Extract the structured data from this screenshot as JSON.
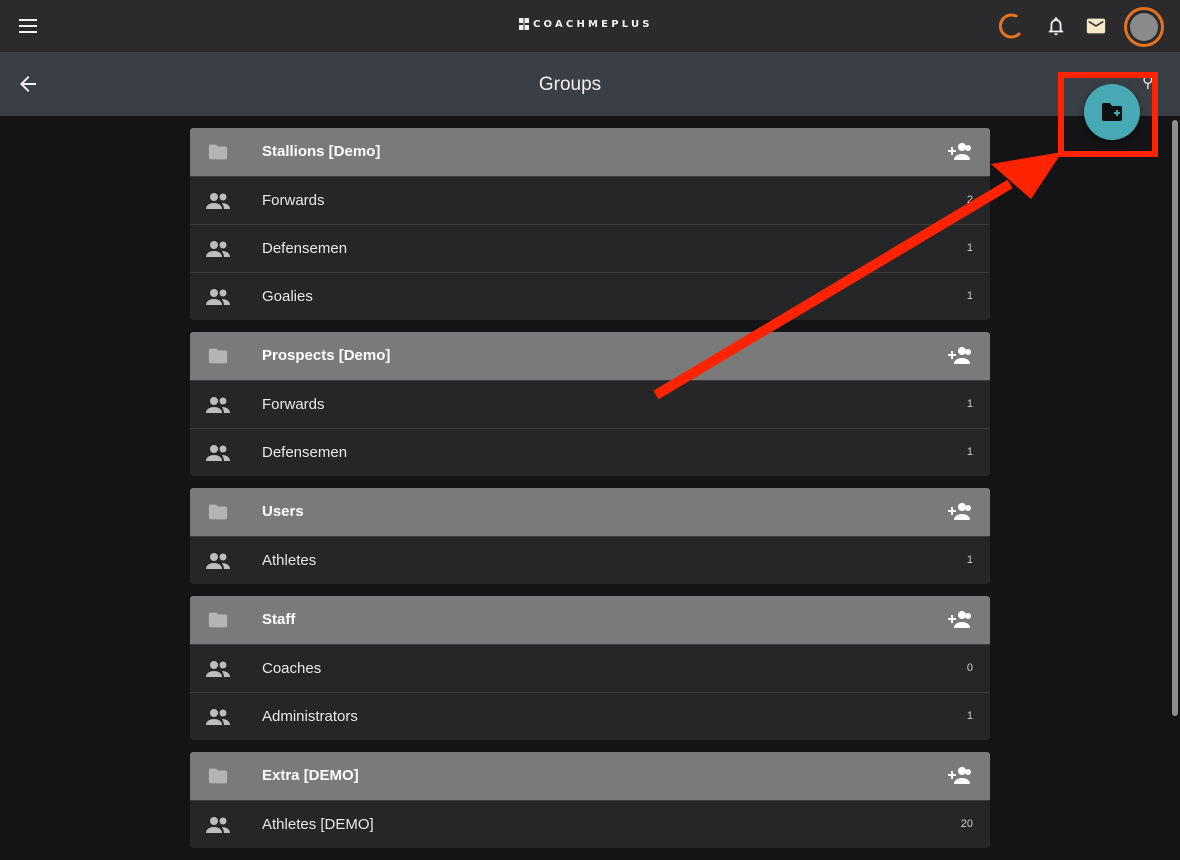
{
  "app": {
    "logo_text": "COACHMEPLUS"
  },
  "header": {
    "title": "Groups"
  },
  "colors": {
    "accent": "#47a9b3",
    "avatar_ring": "#e8731e",
    "annotation": "#ff2300",
    "group_header": "#7a7a7a"
  },
  "icons": {
    "menu": "menu-icon",
    "logo": "logo-mark-icon",
    "loading": "loading-spinner-icon",
    "notifications": "bell-icon",
    "messages": "mail-icon",
    "back": "arrow-back-icon",
    "folder": "folder-icon",
    "add_member": "person-add-icon",
    "group_row": "people-icon",
    "create_folder": "create-new-folder-icon"
  },
  "groups": [
    {
      "name": "Stallions [Demo]",
      "rows": [
        {
          "label": "Forwards",
          "count": "2"
        },
        {
          "label": "Defensemen",
          "count": "1"
        },
        {
          "label": "Goalies",
          "count": "1"
        }
      ]
    },
    {
      "name": "Prospects [Demo]",
      "rows": [
        {
          "label": "Forwards",
          "count": "1"
        },
        {
          "label": "Defensemen",
          "count": "1"
        }
      ]
    },
    {
      "name": "Users",
      "rows": [
        {
          "label": "Athletes",
          "count": "1"
        }
      ]
    },
    {
      "name": "Staff",
      "rows": [
        {
          "label": "Coaches",
          "count": "0"
        },
        {
          "label": "Administrators",
          "count": "1"
        }
      ]
    },
    {
      "name": "Extra [DEMO]",
      "rows": [
        {
          "label": "Athletes [DEMO]",
          "count": "20"
        }
      ]
    }
  ]
}
